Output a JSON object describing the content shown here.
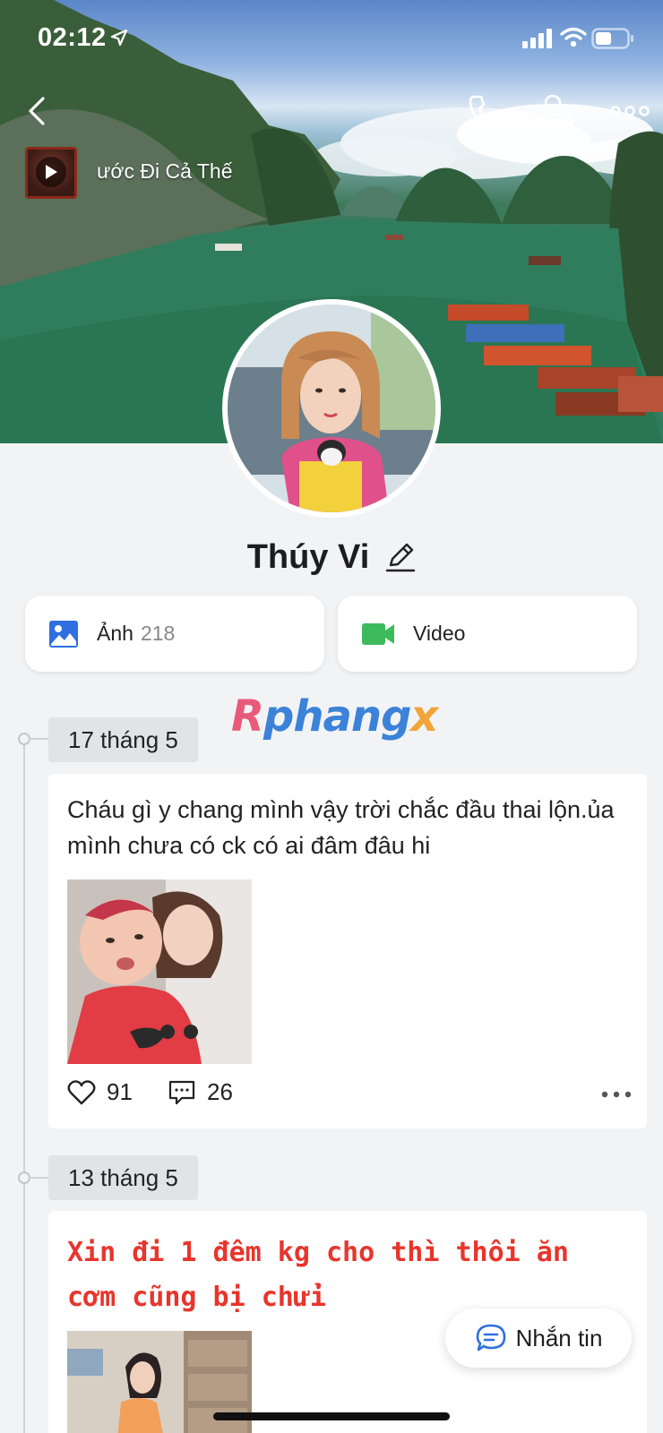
{
  "status_bar": {
    "time": "02:12"
  },
  "profile": {
    "music_title": "ước Đi Cả Thế",
    "name": "Thúy Vi"
  },
  "media": {
    "photos_label": "Ảnh",
    "photos_count": "218",
    "videos_label": "Video"
  },
  "watermark": {
    "part1": "R",
    "part2": "phang",
    "part3": "x"
  },
  "timeline": [
    {
      "date": "17 tháng 5",
      "text": "Cháu gì y chang mình vậy trời chắc đầu thai lộn.ủa mình chưa có ck có ai đâm đâu hi",
      "likes": "91",
      "comments": "26"
    },
    {
      "date": "13 tháng 5",
      "text": "Xin đi 1 đêm kg cho thì thôi ăn cơm cũng bị chửi"
    }
  ],
  "message_button": {
    "label": "Nhắn tin"
  },
  "colors": {
    "accent": "#2f6fe0",
    "video_green": "#3dbb5c",
    "red_text": "#e8352c"
  }
}
